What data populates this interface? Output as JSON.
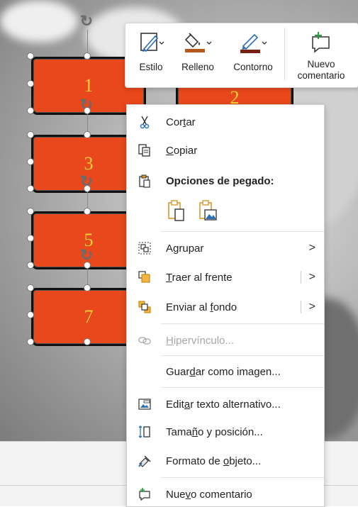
{
  "slide": {
    "shape_labels": [
      "1",
      "2",
      "3",
      "5",
      "7"
    ]
  },
  "mini_toolbar": {
    "style_label": "Estilo",
    "fill_label": "Relleno",
    "outline_label": "Contorno",
    "new_comment_line1": "Nuevo",
    "new_comment_line2": "comentario",
    "fill_color": "#b5581c",
    "outline_color": "#7a1f14"
  },
  "context_menu": {
    "items": [
      {
        "label_pre": "Cor",
        "label_u": "t",
        "label_post": "ar",
        "icon": "scissors-icon"
      },
      {
        "label_pre": "",
        "label_u": "C",
        "label_post": "opiar",
        "icon": "copy-icon"
      },
      {
        "label": "Opciones de pegado:",
        "icon": "paste-icon"
      },
      {
        "label_pre": "A",
        "label_u": "g",
        "label_post": "rupar",
        "icon": "group-icon",
        "chevron": ">"
      },
      {
        "label_pre": "",
        "label_u": "T",
        "label_post": "raer al frente",
        "icon": "bring-to-front-icon",
        "chevron": ">"
      },
      {
        "label_pre": "Enviar al ",
        "label_u": "f",
        "label_post": "ondo",
        "icon": "send-to-back-icon",
        "chevron": ">"
      },
      {
        "label_pre": "",
        "label_u": "H",
        "label_post": "ipervínculo...",
        "icon": "link-icon"
      },
      {
        "label_pre": "Guar",
        "label_u": "d",
        "label_post": "ar como imagen..."
      },
      {
        "label_pre": "Edit",
        "label_u": "a",
        "label_post": "r texto alternativo...",
        "icon": "alt-text-icon"
      },
      {
        "label_pre": "Tama",
        "label_u": "ñ",
        "label_post": "o y posición...",
        "icon": "size-position-icon"
      },
      {
        "label_pre": "Formato de ",
        "label_u": "o",
        "label_post": "bjeto...",
        "icon": "format-object-icon"
      },
      {
        "label_pre": "Nue",
        "label_u": "v",
        "label_post": "o comentario",
        "icon": "new-comment-icon"
      }
    ],
    "accent_color": "#d89a2a"
  }
}
